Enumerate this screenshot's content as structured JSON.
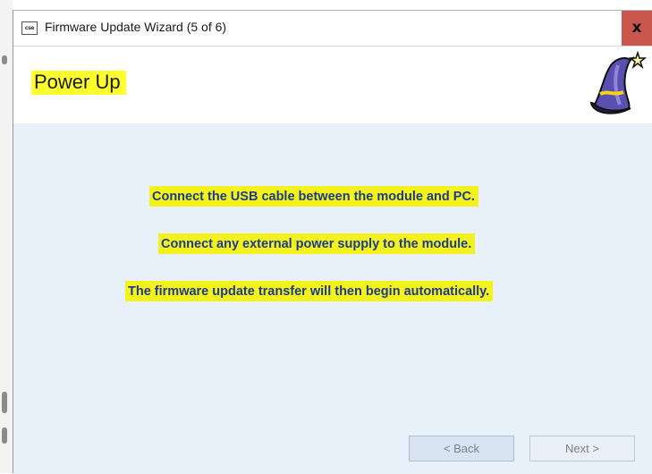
{
  "window": {
    "title": "Firmware Update Wizard (5 of 6)",
    "app_icon_text": "cse",
    "close_label": "x"
  },
  "header": {
    "title": "Power Up"
  },
  "messages": [
    "Connect the USB cable between the module and PC.",
    "Connect any external power supply to the module.",
    "The firmware update transfer will then begin automatically."
  ],
  "buttons": {
    "back": "< Back",
    "next": "Next >"
  },
  "colors": {
    "highlight": "#f4f21c",
    "content_bg": "#e8f1fa",
    "close_bg": "#c9574d",
    "message_text": "#1d3b8a"
  },
  "icons": {
    "wizard": "wizard-hat-icon",
    "app": "app-icon"
  }
}
